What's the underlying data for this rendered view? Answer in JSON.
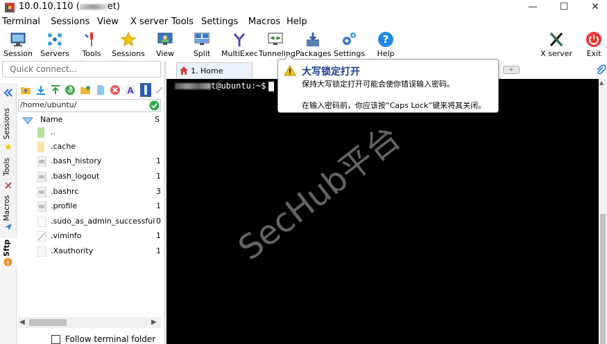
{
  "window": {
    "title_prefix": "10.0.10.110 (",
    "title_suffix": "et)",
    "minimize_glyph": "—",
    "maximize_glyph": "☐",
    "close_glyph": "✕"
  },
  "menu": [
    "Terminal",
    "Sessions",
    "View",
    "X server",
    "Tools",
    "Settings",
    "Macros",
    "Help"
  ],
  "toolbar": {
    "session": "Session",
    "servers": "Servers",
    "tools": "Tools",
    "sessions": "Sessions",
    "view": "View",
    "split": "Split",
    "multiexec": "MultiExec",
    "tunneling": "Tunneling",
    "packages": "Packages",
    "settings": "Settings",
    "help": "Help",
    "xserver": "X server",
    "exit": "Exit"
  },
  "quick_connect": {
    "placeholder": "Quick connect..."
  },
  "sidebar_tabs": {
    "sessions": "Sessions",
    "tools": "Tools",
    "macros": "Macros",
    "sftp": "Sftp"
  },
  "sftp": {
    "path": "/home/ubuntu/",
    "col_name": "Name",
    "col_size": "S",
    "files": [
      {
        "name": "..",
        "size": ""
      },
      {
        "name": ".cache",
        "size": ""
      },
      {
        "name": ".bash_history",
        "size": "1"
      },
      {
        "name": ".bash_logout",
        "size": "1"
      },
      {
        "name": ".bashrc",
        "size": "3"
      },
      {
        "name": ".profile",
        "size": "1"
      },
      {
        "name": ".sudo_as_admin_successful",
        "size": "0"
      },
      {
        "name": ".viminfo",
        "size": "1"
      },
      {
        "name": ".Xauthority",
        "size": "1"
      }
    ],
    "follow_label": "Follow terminal folder"
  },
  "tabs": {
    "home": "1. Home",
    "new_tab_glyph": "+"
  },
  "terminal": {
    "prompt": "t@ubuntu:~$"
  },
  "watermark": "SecHub平台",
  "tooltip": {
    "title": "大写锁定打开",
    "line1": "保持大写锁定打开可能会使你错误输入密码。",
    "line2": "在输入密码前，你应该按“Caps Lock”键来将其关闭。"
  }
}
